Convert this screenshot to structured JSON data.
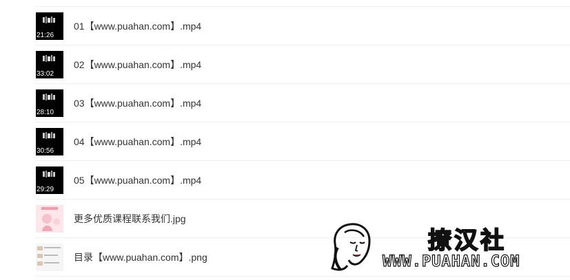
{
  "files": [
    {
      "name": "01【www.puahan.com】.mp4",
      "type": "video",
      "duration": "21:26",
      "thumb": "video-thumbnail"
    },
    {
      "name": "02【www.puahan.com】.mp4",
      "type": "video",
      "duration": "33:02",
      "thumb": "video-thumbnail"
    },
    {
      "name": "03【www.puahan.com】.mp4",
      "type": "video",
      "duration": "28:10",
      "thumb": "video-thumbnail"
    },
    {
      "name": "04【www.puahan.com】.mp4",
      "type": "video",
      "duration": "30:56",
      "thumb": "video-thumbnail"
    },
    {
      "name": "05【www.puahan.com】.mp4",
      "type": "video",
      "duration": "29:29",
      "thumb": "video-thumbnail"
    },
    {
      "name": "更多优质课程联系我们.jpg",
      "type": "image",
      "thumb": "pink-poster-thumbnail"
    },
    {
      "name": "目录【www.puahan.com】.png",
      "type": "image",
      "thumb": "document-thumbnail"
    }
  ],
  "watermark": {
    "brand": "撩汉社",
    "url": "WWW.PUAHAN.COM",
    "logo": "woman-face-line-art"
  },
  "colors": {
    "text": "#333333",
    "divider": "#efefef",
    "video_thumb_bg": "#000000",
    "duration_text": "#ffffff"
  }
}
